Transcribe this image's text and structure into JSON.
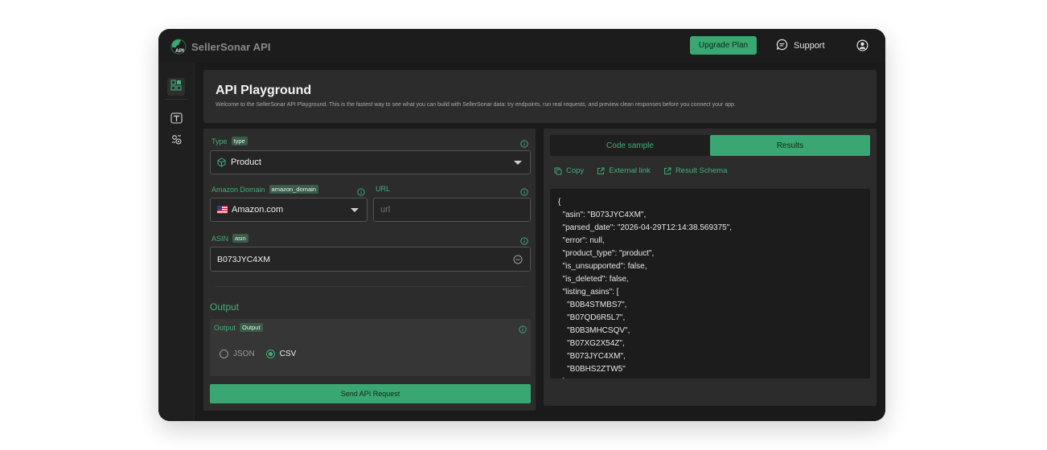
{
  "brand": {
    "name": "SellerSonar API",
    "logo_badge": "API",
    "logo_icon": "sonar-logo-icon"
  },
  "topbar": {
    "upgrade_label": "Upgrade Plan",
    "support_label": "Support",
    "support_icon": "chat-bubble-icon",
    "user_icon": "user-circle-icon"
  },
  "sidebar": {
    "items": [
      {
        "name": "dashboard",
        "icon": "grid-icon",
        "active": true
      },
      {
        "name": "text",
        "icon": "text-icon",
        "active": false
      },
      {
        "name": "settings",
        "icon": "gear-icon",
        "active": false
      }
    ]
  },
  "header": {
    "title": "API Playground",
    "subtitle": "Welcome to the SellerSonar API Playground. This is the fastest way to see what you can build with SellerSonar data: try endpoints, run real requests, and preview clean responses before you connect your app."
  },
  "form": {
    "type": {
      "label": "Type",
      "tag": "type",
      "value": "Product",
      "icon": "cube-icon"
    },
    "domain": {
      "label": "Amazon Domain",
      "tag": "amazon_domain",
      "value": "Amazon.com",
      "icon": "us-flag-icon"
    },
    "url": {
      "label": "URL",
      "placeholder": "url"
    },
    "asin": {
      "label": "ASIN",
      "tag": "asin",
      "value": "B073JYC4XM"
    },
    "output_section_title": "Output",
    "output": {
      "label": "Output",
      "tag": "Output",
      "options": [
        "JSON",
        "CSV"
      ],
      "selected": "CSV"
    },
    "send_label": "Send API Request"
  },
  "results": {
    "tabs": [
      {
        "label": "Code sample",
        "active": false
      },
      {
        "label": "Results",
        "active": true
      }
    ],
    "actions": [
      {
        "label": "Copy",
        "icon": "copy-icon"
      },
      {
        "label": "External link",
        "icon": "external-link-icon"
      },
      {
        "label": "Result Schema",
        "icon": "external-link-icon"
      }
    ],
    "code_lines": [
      "{",
      "  \"asin\": \"B073JYC4XM\",",
      "  \"parsed_date\": \"2026-04-29T12:14:38.569375\",",
      "  \"error\": null,",
      "  \"product_type\": \"product\",",
      "  \"is_unsupported\": false,",
      "  \"is_deleted\": false,",
      "  \"listing_asins\": [",
      "    \"B0B4STMBS7\",",
      "    \"B07QD6R5L7\",",
      "    \"B0B3MHCSQV\",",
      "    \"B07XG2X54Z\",",
      "    \"B073JYC4XM\",",
      "    \"B0BHS2ZTW5\"",
      "  ],"
    ]
  },
  "colors": {
    "accent": "#3aa671",
    "accent_text": "#3fb07a",
    "background": "#191919",
    "panel": "#2c2c2c"
  }
}
